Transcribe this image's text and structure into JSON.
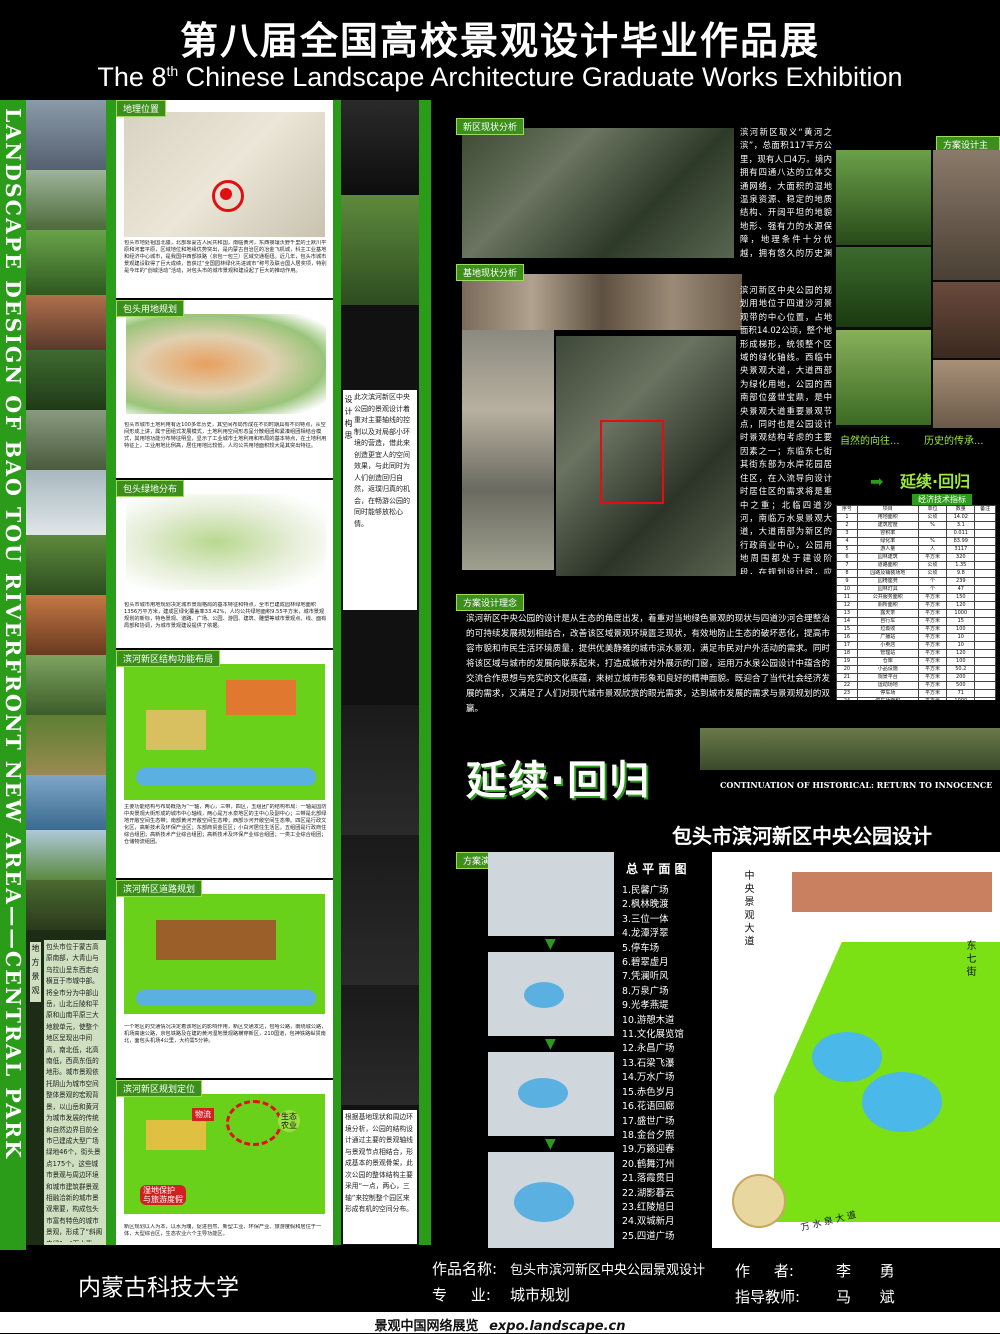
{
  "header": {
    "title_cn": "第八届全国高校景观设计毕业作品展",
    "title_en_pre": "The 8",
    "title_en_sup": "th",
    "title_en_post": " Chinese Landscape Architecture Graduate Works Exhibition"
  },
  "side_vertical_text": "LANDSCAPE DESIGN OF BAO TOU  RIVERFRONT NEW AREA——CENTRAL PARK",
  "left_column": {
    "vertical_label": "地方景观",
    "intro_text": "包头市位于蒙古高原南部，大青山与乌拉山呈东西走向横亘于市城中部。将全市分为中部山岳，山北丘陵和平原和山南平原三大地貌单元，使整个地区呈现出中间高，南北低，北高南低，西高东低的地形。城市景观依托阴山为城市空间整体景观的宏观背景，以山岳和黄河为城市发展的传统和自然边界目前全市已建成大型广场绿地46个，街头景点175个。这些城市景观与周边环境和城市建筑群景观相融洽新的城市景观需要，构成包头市富有特色的城市景观，形成了“斜阁串绿”，“面水背山”式为特征的城市景观环境格局。"
  },
  "sections": {
    "location": {
      "tag": "地理位置",
      "text": "包头市地处祖国北疆，北部靠蒙古人民共和国，南临黄河，东西接壤沃野千里的土默川平原和河套平原，区域地位和地缘优势突出，是内蒙古自治区的冶金飞机城，科主工业基地和经济中心城市，是我国中西部铁路（京包一包兰）区域交通枢纽。近几年，包头市城市景观建设取得了巨大成绩，曾获过“全国园林绿化先进城市”称号及联合国人居奖项，特别是今年的“创城活动”活动，对包头市的城市景观和建设起了巨大的推动作用。"
    },
    "land_use": {
      "tag": "包头用地规划",
      "text": "包头市城市土地利用有近100多年历史，其空间布局形成在不同时期具有不同特点，从空间形成上讲，属于团组式发展模式，土地利用空间形态呈分散组团和紧凑组团相结合模式，其用地功能分布特征明显，显示了工业城市土地利用和布局的基本特点，在土地利用特征上，工业用地比例高，居住用地比较低，人均公共用地面积较大是其突出特征。"
    },
    "green": {
      "tag": "包头绿地分布",
      "text": "包头市城市用地规划决定城市景观格局的基本特征和特点，全市已建成园林绿地面积1356万平方米，建成区绿化覆盖率33.42%，人均公共绿地面积9.55平方米，城市景观规划的新标，特色景观、道路、广场、公园、游园、建筑、雕塑等城市景观点、线、面有局部和协调，为城市景观建设提供了依据。"
    },
    "function": {
      "tag": "滨河新区结构功能布局",
      "text": "主要功能结构与布局概括为“一轴，两心，三带，四区，五组团”的结构布局：一轴是国防中央景观大街形成的城市中心轴线，两心是万水泉地区的主中心及副中心；三带是北部绿地开敞空间生态带；南部黄河开敞空间生态带；西部沙河开敞空间生态带。四区是行政文化区，高新技术及环保产业区；东部商贸金区区；小白河居住生活区。五组团是行政商住综合组团；高新技术产业综合组团；高新技术及环保产业综合组团；一类工业综合组团；仓储物流组团。"
    },
    "road": {
      "tag": "滨河新区道路规划",
      "text": "一个地区的交通情况决定着该地区的影响作用，新区交通发达，包哈公路，南绕城公路，机场高速公路，京包铁路及在建的黄河湿地景观路横穿新区，210国道，包神铁路纵贯南北，面包头机场4公里，大约需5分钟。"
    },
    "position": {
      "tag": "滨河新区规划定位",
      "text": "新区规划以人为本，以水为魂，促进自然、新型工业、环保产业、旅游度假和居住于一体，大型综合区，生态农业六个主导功能区。",
      "callouts": [
        "湿地保护\n与旅游度假",
        "生态\n农业",
        "物流"
      ]
    }
  },
  "sketch_text": "根据基地现状和周边环境分析，公园的结构设计通过主要的景观轴线与景观节点相结合，形成基本的景观骨架，此次公园的整体结构主要采用“一点，两心，三轴”来控制整个园区来形成有机的空间分布。",
  "sketch_text2": "此次滨河新区中央公园的景观设计着重对主要轴线的控制以及对局部小环境的营造，借此来创造更宜人的空间效果，与此同时为人们创造回归自然，返璞归真的机会，在畅游公园的同时能够放松心情。",
  "sketch_vertical": "设计构思",
  "site_analysis": {
    "tag": "新区现状分析",
    "text": "滨河新区取义“黄河之滨”，总面积117平方公里，现有人口4万。境内拥有四通八达的立体交通网络，大面积的湿地温泉资源、稳定的地质结构、开阔平坦的地貌地形、强有力的水源保障，地理条件十分优越，拥有悠久的历史渊源，极具开发潜力。"
  },
  "base_analysis": {
    "tag": "基地现状分析",
    "text": "滨河新区中央公园的规划用地位于四道沙河景观带的中心位置，占地面积14.02公顷，整个地形成梯形，统领整个区域的绿化轴线。西临中央景观大道，大道西部为绿化用地，公园的西南部位盛世宝鼎，是中央景观大道重要景观节点，同时也是公园设计时景观结构考虑的主要因素之一；东临东七街其街东部为水岸花园居住区，在入流导向设计时居住区的需求将是重中之重；北临四道沙河，南临万水泉景观大道，大道南部为新区的行政商业中心，公园用地周围都处于建设阶段，在规划设计时，应充分考虑公园的预留与发展的需求。"
  },
  "design_concept": {
    "tag": "方案设计理念",
    "text": "滨河新区中央公园的设计是从生态的角度出发，着重对当地绿色景观的现状与四道沙河合理整治的可持续发展规划相结合，改善该区域景观环境匮乏现状，有效地防止生态的破坏恶化，提高市容市貌和市民生活环境质量，提供优美静雅的城市滨水景观，满足市民对户外活动的需求。同时将该区域与城市的发展向联系起来，打造成城市对外展示的门窗，运用万水泉公园设计中蕴含的交流合作思想与充实的文化底蕴，来树立城市形象和良好的精神面貌。既迎合了当代社会经济发展的需求，又满足了人们对现代城市景观欣赏的眼光需求，达到城市发展的需求与景观规划的双赢。"
  },
  "theme": {
    "tag": "方案设计主题",
    "caption_left": "自然的向往...",
    "caption_right": "历史的传承...",
    "arrow_text": "延续·回归",
    "big_title": "延续·回归",
    "continuation_en": "CONTINUATION OF HISTORICAL: RETURN TO INNOCENCE",
    "project_title": "包头市滨河新区中央公园设计"
  },
  "eco_table": {
    "title": "经济技术指标",
    "header": [
      "序号",
      "项目",
      "单位",
      "数量",
      "备注"
    ],
    "rows": [
      [
        "1",
        "用地面积",
        "公顷",
        "14.02",
        ""
      ],
      [
        "2",
        "建筑密度",
        "%",
        "3.1",
        ""
      ],
      [
        "3",
        "容积率",
        "",
        "0.011",
        ""
      ],
      [
        "4",
        "绿化率",
        "%",
        "83.99",
        ""
      ],
      [
        "5",
        "游人量",
        "人",
        "3117",
        ""
      ],
      [
        "6",
        "园林建筑",
        "平方米",
        "320",
        ""
      ],
      [
        "7",
        "道路面积",
        "公顷",
        "1.35",
        ""
      ],
      [
        "8",
        "园路及铺装场地",
        "公顷",
        "9.8",
        ""
      ],
      [
        "9",
        "园椅座凳",
        "个",
        "239",
        ""
      ],
      [
        "10",
        "园林灯具",
        "个",
        "47",
        ""
      ],
      [
        "11",
        "公共服务面积",
        "平方米",
        "150",
        ""
      ],
      [
        "12",
        "厕所面积",
        "平方米",
        "120",
        ""
      ],
      [
        "13",
        "露天茶",
        "平方米",
        "1000",
        ""
      ],
      [
        "14",
        "自行车",
        "平方米",
        "15",
        ""
      ],
      [
        "15",
        "垃圾收",
        "平方米",
        "100",
        ""
      ],
      [
        "16",
        "广播站",
        "平方米",
        "10",
        ""
      ],
      [
        "17",
        "小卖店",
        "平方米",
        "10",
        ""
      ],
      [
        "18",
        "管理站",
        "平方米",
        "120",
        ""
      ],
      [
        "19",
        "仓库",
        "平方米",
        "100",
        ""
      ],
      [
        "20",
        "小品设施",
        "平方米",
        "50.2",
        ""
      ],
      [
        "21",
        "观景平台",
        "平方米",
        "200",
        ""
      ],
      [
        "22",
        "运动场地",
        "平方米",
        "500",
        ""
      ],
      [
        "23",
        "停车场",
        "平方米",
        "71",
        ""
      ],
      [
        "24",
        "停车场面积",
        "平方米",
        "1000",
        ""
      ]
    ]
  },
  "evolution": {
    "tag": "方案演进",
    "plan_title": "总  平  面  图"
  },
  "plan_legend": [
    "1.民馨广场",
    "2.枫林晚渡",
    "3.三位一体",
    "4.龙潭浮翠",
    "5.停车场",
    "6.碧翠虚月",
    "7.凭澜听风",
    "8.万泉广场",
    "9.光孝燕堤",
    "10.游憩木道",
    "11.文化展览馆",
    "12.永昌广场",
    "13.石梁飞瀑",
    "14.万水广场",
    "15.赤色岁月",
    "16.花语回廊",
    "17.盛世广场",
    "18.金台夕照",
    "19.万籁迎春",
    "20.鹤舞汀州",
    "21.落霞贯日",
    "22.湖影暮云",
    "23.红陵旭日",
    "24.双城新月",
    "25.四道广场"
  ],
  "plan_road_labels": {
    "left": "中  央  景  观  大  道",
    "right": "东  七  街",
    "bottom": "万  水  泉  大  道"
  },
  "footer": {
    "university": "内蒙古科技大学",
    "work_label": "作品名称:",
    "work_name": "包头市滨河新区中央公园景观设计",
    "author_label": "作     者:",
    "author": "李      勇",
    "major_label": "专     业:",
    "major": "城市规划",
    "advisor_label": "指导教师:",
    "advisor": "马      斌",
    "bottom_cn": "景观中国网络展览",
    "bottom_url": "expo.landscape.cn"
  },
  "colors": {
    "accent_green": "#2b9c19",
    "tag_green": "#3b8f1a",
    "plan_lime": "#7be014",
    "background": "#000000"
  }
}
